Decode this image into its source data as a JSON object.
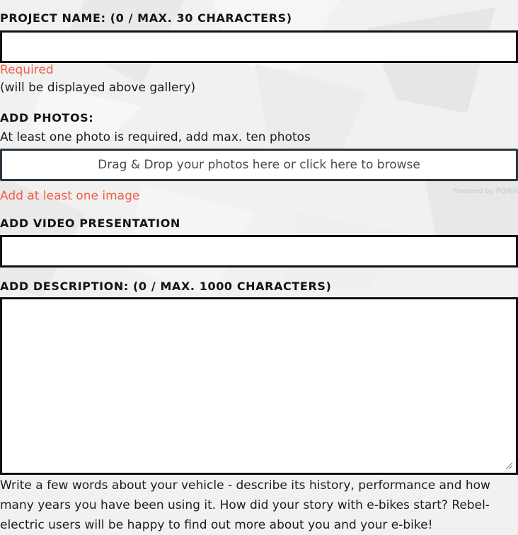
{
  "project_name": {
    "label": "PROJECT NAME: (0 / MAX. 30 CHARACTERS)",
    "value": "",
    "error": "Required",
    "hint": "(will be displayed above gallery)"
  },
  "photos": {
    "label": "ADD PHOTOS:",
    "hint": "At least one photo is required, add max. ten photos",
    "dropzone_text": "Drag & Drop your photos here or click here to browse",
    "error": "Add at least one image",
    "powered_by": "Powered by PQINA"
  },
  "video": {
    "label": "ADD VIDEO PRESENTATION",
    "value": ""
  },
  "description": {
    "label": "ADD DESCRIPTION: (0 / MAX. 1000 CHARACTERS)",
    "value": "",
    "hint": "Write a few words about your vehicle - describe its history, performance and how many years you have been using it. How did your story with e-bikes start? Rebel-electric users will be happy to find out more about you and your e-bike!"
  }
}
